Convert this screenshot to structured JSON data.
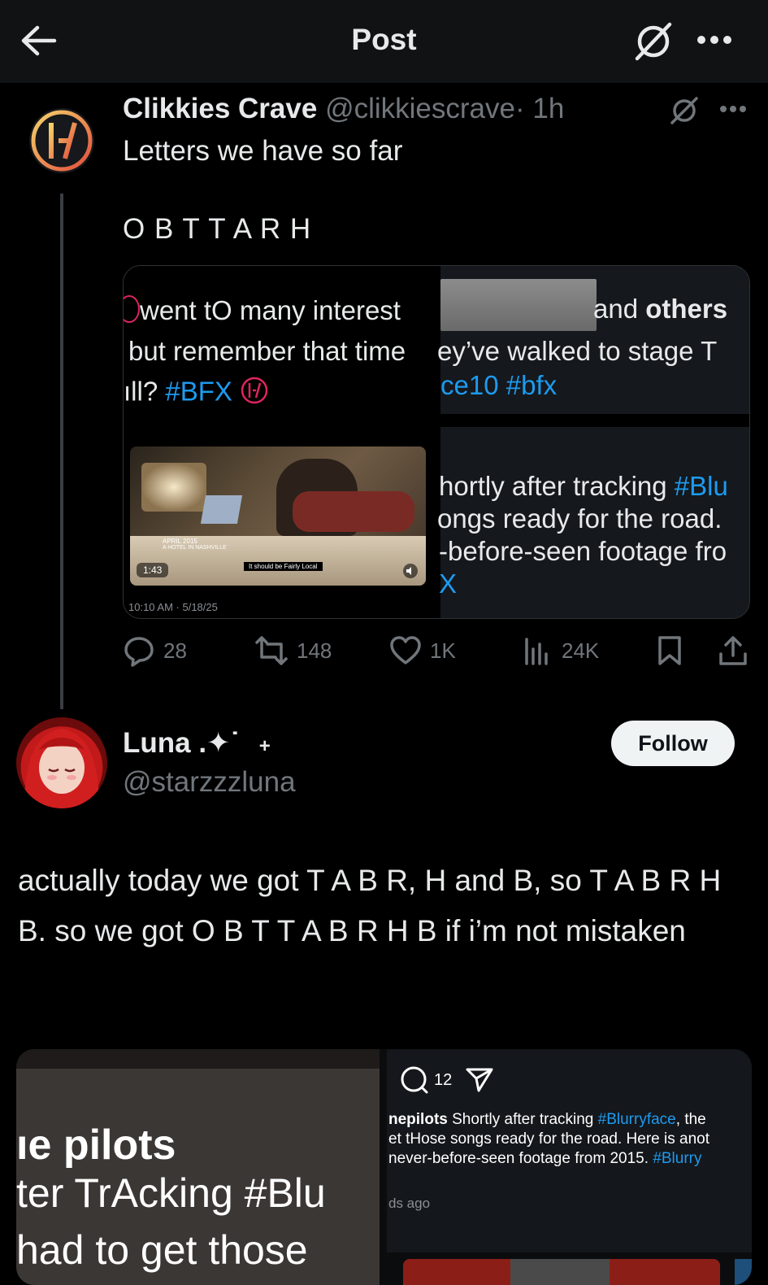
{
  "header": {
    "title": "Post"
  },
  "quoted_post": {
    "author_name": "Clikkies Crave",
    "handle": "@clikkiescrave",
    "time": "· 1h",
    "text_line1": "Letters we have so far",
    "text_line2": "O B T T A R H",
    "card": {
      "left_line1": "went tO many interest",
      "left_line2": "but remember that time",
      "left_line3_prefix": "ıll?",
      "left_hashtag": "#BFX",
      "right_line1_prefix": "and",
      "right_line1_bold": "others",
      "right_line2": "ey’ve walked to stage T",
      "right_line3_prefix": "ce10",
      "right_line3_hashtag": "#bfx",
      "right_line4_prefix": "hortly after tracking",
      "right_line4_hashtag": "#Blu",
      "right_line5": "ongs ready for the road.",
      "right_line6": "-before-seen footage fro",
      "right_line7": "X",
      "video_caption_date": "APRIL 2015",
      "video_caption_place": "A HOTEL IN NASHVILLE",
      "video_duration": "1:43",
      "video_subtitle": "It should be Fairly Local",
      "timestamp": "10:10 AM · 5/18/25"
    },
    "actions": {
      "replies": "28",
      "reposts": "148",
      "likes": "1K",
      "views": "24K"
    }
  },
  "reply": {
    "author_name": "Luna .✦˙",
    "badge": "+",
    "handle": "@starzzzluna",
    "follow_label": "Follow",
    "text": "actually today we got T A B R, H and B, so T A B R H B. so we got O B T T A B R H B if i’m not mistaken",
    "media": {
      "left_line1": "ıe pilots",
      "left_line2": "ter TrAcking #Blu",
      "left_line3": "had to get those",
      "comment_count": "12",
      "caption_user": "nepilots",
      "caption_text1": "Shortly after tracking",
      "caption_hashtag1": "#Blurryface",
      "caption_text1b": ", the",
      "caption_line2": "et tHose songs ready for the road. Here is anot",
      "caption_line3": "never-before-seen footage from 2015.",
      "caption_hashtag2": "#Blurry",
      "caption_time": "ds ago"
    }
  },
  "colors": {
    "background": "#000000",
    "accent": "#1d9bf0",
    "muted": "#71767b",
    "text": "#e7e9ea"
  }
}
